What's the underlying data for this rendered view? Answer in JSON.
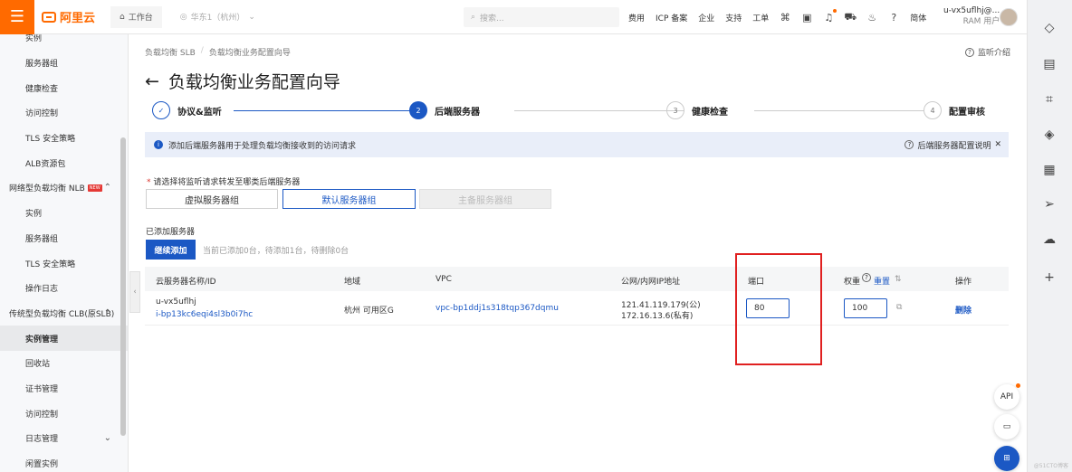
{
  "topbar": {
    "brand": "阿里云",
    "workspace": "工作台",
    "region": "华东1（杭州）",
    "search_placeholder": "搜索...",
    "nav": [
      "费用",
      "ICP 备案",
      "企业",
      "支持",
      "工单"
    ],
    "lang": "简体",
    "user_name": "u-vx5uflhj@...",
    "user_role": "RAM 用户"
  },
  "sidebar": {
    "items": [
      {
        "label": "实例",
        "type": "sub"
      },
      {
        "label": "服务器组",
        "type": "sub"
      },
      {
        "label": "健康检查",
        "type": "sub"
      },
      {
        "label": "访问控制",
        "type": "sub"
      },
      {
        "label": "TLS 安全策略",
        "type": "sub"
      },
      {
        "label": "ALB资源包",
        "type": "sub"
      },
      {
        "label": "网络型负载均衡 NLB",
        "type": "group",
        "badge": "NEW"
      },
      {
        "label": "实例",
        "type": "sub"
      },
      {
        "label": "服务器组",
        "type": "sub"
      },
      {
        "label": "TLS 安全策略",
        "type": "sub"
      },
      {
        "label": "操作日志",
        "type": "sub"
      },
      {
        "label": "传统型负载均衡 CLB(原SLB)",
        "type": "group"
      },
      {
        "label": "实例管理",
        "type": "sub",
        "active": true
      },
      {
        "label": "回收站",
        "type": "sub"
      },
      {
        "label": "证书管理",
        "type": "sub"
      },
      {
        "label": "访问控制",
        "type": "sub"
      },
      {
        "label": "日志管理",
        "type": "sub"
      },
      {
        "label": "闲置实例",
        "type": "sub"
      }
    ]
  },
  "breadcrumb": [
    "负载均衡 SLB",
    "负载均衡业务配置向导"
  ],
  "help_link": "监听介绍",
  "page_title": "负载均衡业务配置向导",
  "steps": [
    {
      "num": "✓",
      "label": "协议&监听",
      "state": "done"
    },
    {
      "num": "2",
      "label": "后端服务器",
      "state": "current"
    },
    {
      "num": "3",
      "label": "健康检查",
      "state": "todo"
    },
    {
      "num": "4",
      "label": "配置审核",
      "state": "todo"
    }
  ],
  "info_banner": {
    "text": "添加后端服务器用于处理负载均衡接收到的访问请求",
    "help": "后端服务器配置说明"
  },
  "forward_prompt": "请选择将监听请求转发至哪类后端服务器",
  "server_types": [
    {
      "label": "虚拟服务器组",
      "state": "normal"
    },
    {
      "label": "默认服务器组",
      "state": "selected"
    },
    {
      "label": "主备服务器组",
      "state": "disabled"
    }
  ],
  "added_label": "已添加服务器",
  "continue_button": "继续添加",
  "count_text": "当前已添加0台，待添加1台，待删除0台",
  "table": {
    "headers": [
      "云服务器名称/ID",
      "地域",
      "VPC",
      "公网/内网IP地址",
      "端口",
      "权重",
      "重置",
      "操作"
    ],
    "rows": [
      {
        "name": "u-vx5uflhj",
        "id": "i-bp13kc6eqi4sl3b0i7hc",
        "region": "杭州 可用区G",
        "vpc": "vpc-bp1ddj1s318tqp367dqmu",
        "ip_public": "121.41.119.179(公)",
        "ip_private": "172.16.13.6(私有)",
        "port": "80",
        "weight": "100",
        "action": "删除"
      }
    ]
  },
  "floating": {
    "api": "API"
  },
  "watermark": "@51CTO博客",
  "colors": {
    "brand": "#ff6a00",
    "primary": "#1b58c4",
    "highlight": "#e02020"
  }
}
